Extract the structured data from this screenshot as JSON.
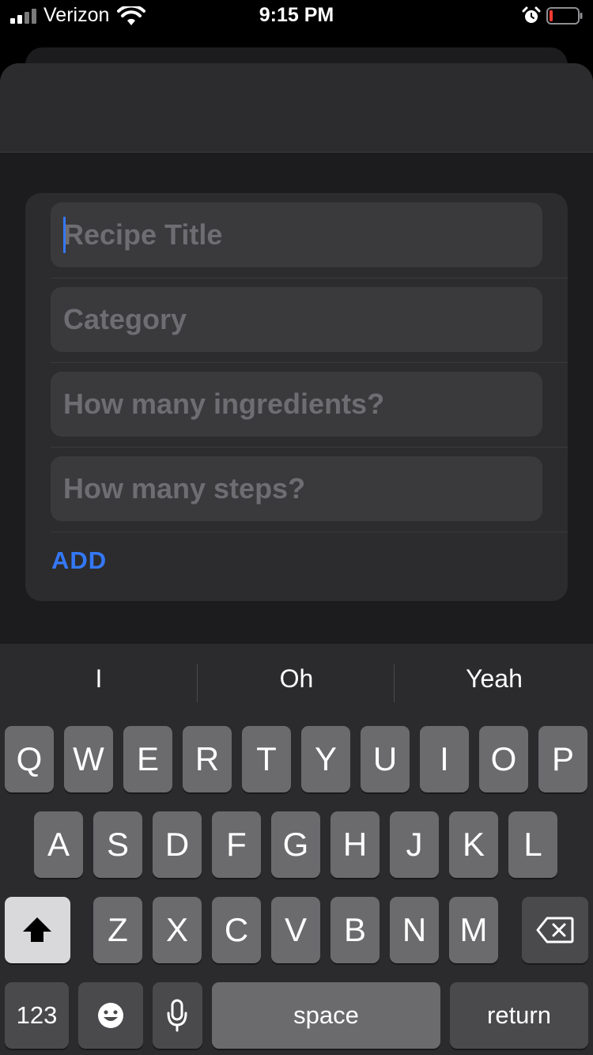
{
  "status_bar": {
    "carrier": "Verizon",
    "time": "9:15 PM"
  },
  "form": {
    "title_placeholder": "Recipe Title",
    "category_placeholder": "Category",
    "ingredients_placeholder": "How many ingredients?",
    "steps_placeholder": "How many steps?",
    "add_label": "ADD"
  },
  "keyboard": {
    "suggestions": [
      "I",
      "Oh",
      "Yeah"
    ],
    "row1": [
      "Q",
      "W",
      "E",
      "R",
      "T",
      "Y",
      "U",
      "I",
      "O",
      "P"
    ],
    "row2": [
      "A",
      "S",
      "D",
      "F",
      "G",
      "H",
      "J",
      "K",
      "L"
    ],
    "row3": [
      "Z",
      "X",
      "C",
      "V",
      "B",
      "N",
      "M"
    ],
    "numbers_label": "123",
    "space_label": "space",
    "return_label": "return"
  },
  "colors": {
    "accent": "#3478f6",
    "battery_low": "#ff3b30"
  }
}
